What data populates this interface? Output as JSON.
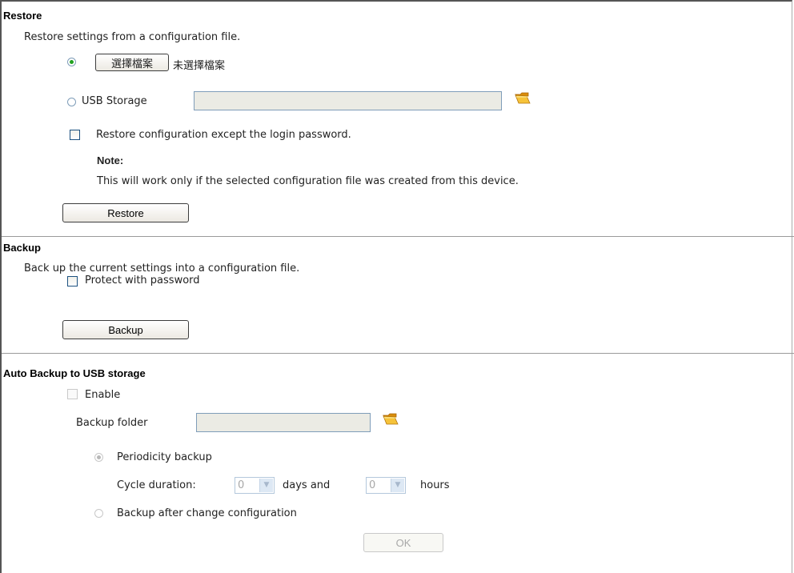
{
  "restore": {
    "title": "Restore",
    "description": "Restore settings from a configuration file.",
    "file_button_label": "選擇檔案",
    "file_status": "未選擇檔案",
    "usb_label": "USB Storage",
    "usb_value": "",
    "except_password_label": "Restore configuration except the login password.",
    "note_title": "Note:",
    "note_text": "This will work only if the selected configuration file was created from this device.",
    "button_label": "Restore",
    "file_option_selected": true,
    "except_password_checked": false
  },
  "backup": {
    "title": "Backup",
    "description": "Back up the current settings into a configuration file.",
    "protect_label": "Protect with password",
    "protect_checked": false,
    "button_label": "Backup"
  },
  "auto_backup": {
    "title": "Auto Backup to USB storage",
    "enable_label": "Enable",
    "enable_checked": false,
    "folder_label": "Backup folder",
    "folder_value": "",
    "periodicity_label": "Periodicity backup",
    "periodicity_selected": true,
    "cycle_label": "Cycle duration:",
    "days_value": "0",
    "days_label": "days and",
    "hours_value": "0",
    "hours_label": "hours",
    "after_change_label": "Backup after change configuration",
    "ok_label": "OK"
  },
  "icons": {
    "folder": "folder-open-icon",
    "folder_color": "#f2b01e"
  }
}
